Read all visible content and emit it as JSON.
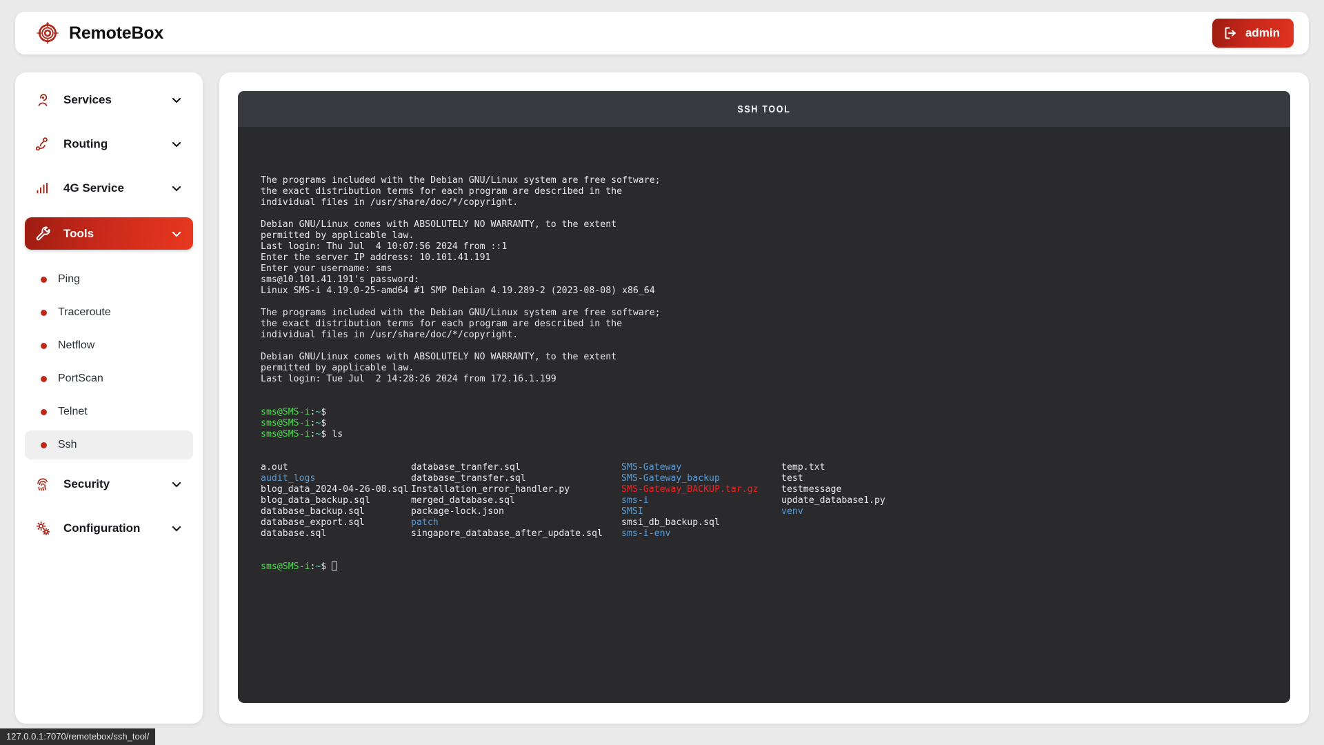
{
  "header": {
    "brand_name": "RemoteBox",
    "logo_icon": "target-circuit-logo-icon",
    "admin_label": "admin",
    "admin_icon": "logout-icon"
  },
  "sidebar": {
    "items": [
      {
        "label": "Services",
        "icon": "broadcast-antenna-icon",
        "chevron": "chevron-down-icon",
        "active": false
      },
      {
        "label": "Routing",
        "icon": "route-nodes-icon",
        "chevron": "chevron-down-icon",
        "active": false
      },
      {
        "label": "4G Service",
        "icon": "signal-bars-icon",
        "chevron": "chevron-down-icon",
        "active": false
      },
      {
        "label": "Tools",
        "icon": "wrench-icon",
        "chevron": "chevron-down-icon",
        "active": true
      },
      {
        "label": "Security",
        "icon": "fingerprint-icon",
        "chevron": "chevron-down-icon",
        "active": false
      },
      {
        "label": "Configuration",
        "icon": "gears-icon",
        "chevron": "chevron-down-icon",
        "active": false
      }
    ],
    "tools_subitems": [
      {
        "label": "Ping",
        "selected": false
      },
      {
        "label": "Traceroute",
        "selected": false
      },
      {
        "label": "Netflow",
        "selected": false
      },
      {
        "label": "PortScan",
        "selected": false
      },
      {
        "label": "Telnet",
        "selected": false
      },
      {
        "label": "Ssh",
        "selected": true
      }
    ]
  },
  "terminal": {
    "title": "SSH TOOL",
    "lines": [
      "The programs included with the Debian GNU/Linux system are free software;",
      "the exact distribution terms for each program are described in the",
      "individual files in /usr/share/doc/*/copyright.",
      "",
      "Debian GNU/Linux comes with ABSOLUTELY NO WARRANTY, to the extent",
      "permitted by applicable law.",
      "Last login: Thu Jul  4 10:07:56 2024 from ::1",
      "Enter the server IP address: 10.101.41.191",
      "Enter your username: sms",
      "sms@10.101.41.191's password:",
      "Linux SMS-i 4.19.0-25-amd64 #1 SMP Debian 4.19.289-2 (2023-08-08) x86_64",
      "",
      "The programs included with the Debian GNU/Linux system are free software;",
      "the exact distribution terms for each program are described in the",
      "individual files in /usr/share/doc/*/copyright.",
      "",
      "Debian GNU/Linux comes with ABSOLUTELY NO WARRANTY, to the extent",
      "permitted by applicable law.",
      "Last login: Tue Jul  2 14:28:26 2024 from 172.16.1.199"
    ],
    "prompt": {
      "user_host": "sms@SMS-i",
      "colon": ":",
      "path": "~",
      "sigil": "$"
    },
    "prompt_lines": [
      {
        "command": ""
      },
      {
        "command": ""
      },
      {
        "command": "ls"
      }
    ],
    "ls_rows": [
      [
        {
          "name": "a.out",
          "kind": "file"
        },
        {
          "name": "database_tranfer.sql",
          "kind": "file"
        },
        {
          "name": "SMS-Gateway",
          "kind": "dir"
        },
        {
          "name": "temp.txt",
          "kind": "file"
        }
      ],
      [
        {
          "name": "audit_logs",
          "kind": "dir"
        },
        {
          "name": "database_transfer.sql",
          "kind": "file"
        },
        {
          "name": "SMS-Gateway_backup",
          "kind": "dir"
        },
        {
          "name": "test",
          "kind": "file"
        }
      ],
      [
        {
          "name": "blog_data_2024-04-26-08.sql",
          "kind": "file"
        },
        {
          "name": "Installation_error_handler.py",
          "kind": "file"
        },
        {
          "name": "SMS-Gateway_BACKUP.tar.gz",
          "kind": "archive"
        },
        {
          "name": "testmessage",
          "kind": "file"
        }
      ],
      [
        {
          "name": "blog_data_backup.sql",
          "kind": "file"
        },
        {
          "name": "merged_database.sql",
          "kind": "file"
        },
        {
          "name": "sms-i",
          "kind": "dir"
        },
        {
          "name": "update_database1.py",
          "kind": "file"
        }
      ],
      [
        {
          "name": "database_backup.sql",
          "kind": "file"
        },
        {
          "name": "package-lock.json",
          "kind": "file"
        },
        {
          "name": "SMSI",
          "kind": "dir"
        },
        {
          "name": "venv",
          "kind": "dir"
        }
      ],
      [
        {
          "name": "database_export.sql",
          "kind": "file"
        },
        {
          "name": "patch",
          "kind": "dir"
        },
        {
          "name": "smsi_db_backup.sql",
          "kind": "file"
        },
        {
          "name": "",
          "kind": "file"
        }
      ],
      [
        {
          "name": "database.sql",
          "kind": "file"
        },
        {
          "name": "singapore_database_after_update.sql",
          "kind": "file"
        },
        {
          "name": "sms-i-env",
          "kind": "dir"
        },
        {
          "name": "",
          "kind": "file"
        }
      ]
    ],
    "final_prompt_cursor": true
  },
  "status_bar": {
    "url": "127.0.0.1:7070/remotebox/ssh_tool/"
  },
  "colors": {
    "accent_red": "#c8271a",
    "accent_red_dark": "#9d1c11",
    "accent_red_bright": "#e8381f",
    "page_bg": "#eaeaea",
    "terminal_bg": "#2a2a2d",
    "terminal_header_bg": "#393940",
    "dir_blue": "#5b9bd5",
    "archive_red": "#f02020",
    "prompt_green": "#4ddc4d",
    "prompt_cyan": "#4ddccf"
  }
}
